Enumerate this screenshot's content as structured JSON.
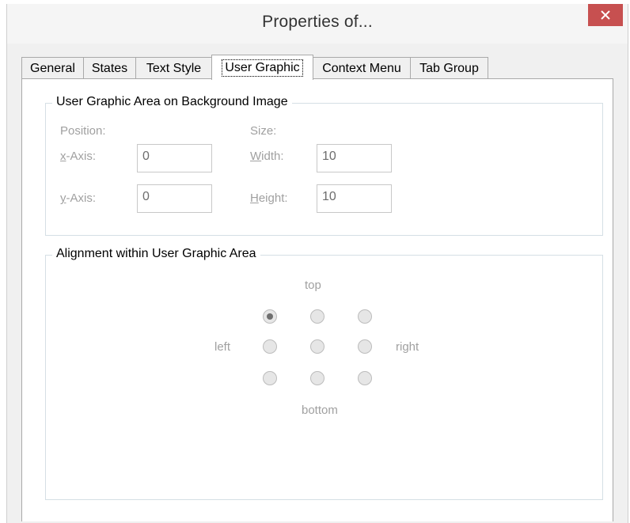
{
  "window": {
    "title": "Properties of...",
    "close_symbol": "close-icon"
  },
  "tabs": [
    {
      "label": "General",
      "active": false
    },
    {
      "label": "States",
      "active": false
    },
    {
      "label": "Text Style",
      "active": false
    },
    {
      "label": "User Graphic",
      "active": true
    },
    {
      "label": "Context Menu",
      "active": false
    },
    {
      "label": "Tab Group",
      "active": false
    }
  ],
  "area_group": {
    "legend": "User Graphic Area on Background Image",
    "position_label": "Position:",
    "size_label": "Size:",
    "x_axis_label": "x-Axis:",
    "x_axis_value": "0",
    "y_axis_label": "y-Axis:",
    "y_axis_value": "0",
    "width_label": "Width:",
    "width_value": "10",
    "height_label": "Height:",
    "height_value": "10"
  },
  "alignment_group": {
    "legend": "Alignment within User Graphic Area",
    "top_label": "top",
    "bottom_label": "bottom",
    "left_label": "left",
    "right_label": "right",
    "selected": "top-left",
    "options": [
      "top-left",
      "top-center",
      "top-right",
      "middle-left",
      "middle-center",
      "middle-right",
      "bottom-left",
      "bottom-center",
      "bottom-right"
    ]
  },
  "colors": {
    "close_button": "#c75050",
    "disabled_text": "#a0a0a0",
    "group_border": "#d5dfe5"
  }
}
